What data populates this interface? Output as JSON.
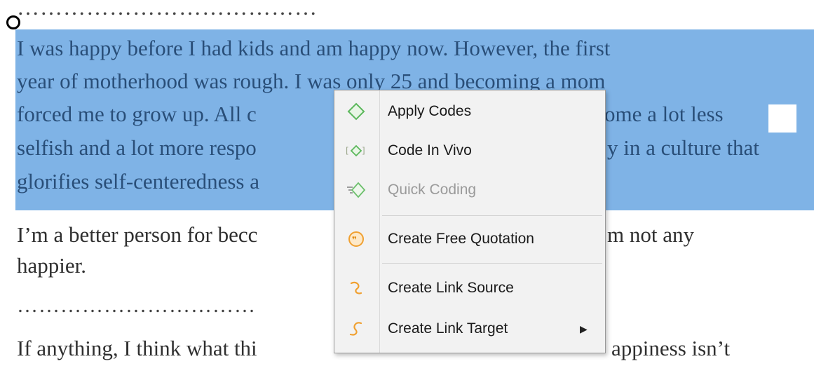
{
  "document": {
    "dots_top": "…………………………………",
    "selected_lines": [
      "I was happy before I had kids and am happy now. However, the first",
      "year of motherhood was rough. I was only 25 and becoming a mom",
      "forced me to grow up. All c",
      "selfish and a lot more respo",
      "glorifies self-centeredness a"
    ],
    "selected_line3_tail": "ome a lot less",
    "selected_line4_tail": "y in a culture that",
    "para2_line1_left": "I’m a better person for becc",
    "para2_line1_right": "m not any",
    "para2_line2": "happier.",
    "dots_middle": "……………………………",
    "para3_left": "If anything, I think what thi",
    "para3_right": "appiness isn’t"
  },
  "context_menu": {
    "items": [
      {
        "label": "Apply Codes",
        "icon": "diamond-icon",
        "disabled": false
      },
      {
        "label": "Code In Vivo",
        "icon": "in-vivo-icon",
        "disabled": false
      },
      {
        "label": "Quick Coding",
        "icon": "quick-coding-icon",
        "disabled": true
      },
      {
        "label": "Create Free Quotation",
        "icon": "quotation-icon",
        "disabled": false
      },
      {
        "label": "Create Link Source",
        "icon": "link-source-icon",
        "disabled": false
      },
      {
        "label": "Create Link Target",
        "icon": "link-target-icon",
        "disabled": false,
        "submenu": true
      }
    ]
  },
  "colors": {
    "selection": "#7fb3e6",
    "code_green": "#5cb85c",
    "quotation_orange": "#f0a030"
  }
}
